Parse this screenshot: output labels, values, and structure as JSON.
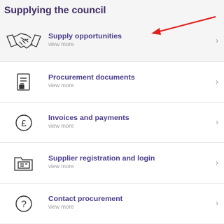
{
  "header": {
    "title": "Supplying the council"
  },
  "items": [
    {
      "title": "Supply opportunities",
      "sub": "view more",
      "icon": "handshake-icon"
    },
    {
      "title": "Procurement documents",
      "sub": "view more",
      "icon": "document-icon"
    },
    {
      "title": "Invoices and payments",
      "sub": "view more",
      "icon": "pound-coin-icon"
    },
    {
      "title": "Supplier registration and login",
      "sub": "view more",
      "icon": "folder-card-icon"
    },
    {
      "title": "Contact procurement",
      "sub": "view more",
      "icon": "question-icon"
    }
  ],
  "chevron": "›",
  "colors": {
    "title": "#3e2a63",
    "link": "#4a3b8a",
    "annotation_arrow": "#e11d1d"
  }
}
